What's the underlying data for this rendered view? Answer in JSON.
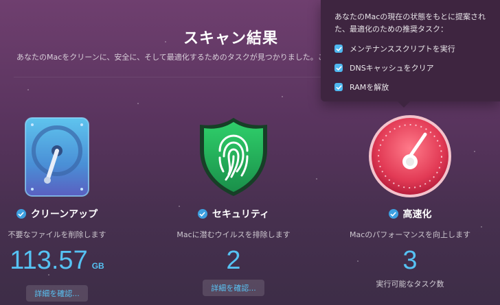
{
  "page": {
    "title": "スキャン結果",
    "subtitle": "あなたのMacをクリーンに、安全に、そして最適化するためのタスクが見つかりました。こ"
  },
  "sections": [
    {
      "title": "クリーンアップ",
      "description": "不要なファイルを削除します",
      "value": "113.57",
      "unit": "GB",
      "button_label": "詳細を確認...",
      "icon": "hard-drive-icon"
    },
    {
      "title": "セキュリティ",
      "description": "Macに潜むウイルスを排除します",
      "value": "2",
      "button_label": "詳細を確認...",
      "icon": "fingerprint-shield-icon"
    },
    {
      "title": "高速化",
      "description": "Macのパフォーマンスを向上します",
      "value": "3",
      "caption": "実行可能なタスク数",
      "icon": "speedometer-icon"
    }
  ],
  "tooltip": {
    "text": "あなたのMacの現在の状態をもとに提案された、最適化のための推奨タスク：",
    "tasks": [
      "メンテナンススクリプトを実行",
      "DNSキャッシュをクリア",
      "RAMを解放"
    ]
  },
  "colors": {
    "accent": "#56c2f3",
    "check": "#3da0e0",
    "tooltip_bg": "#3e2540"
  }
}
